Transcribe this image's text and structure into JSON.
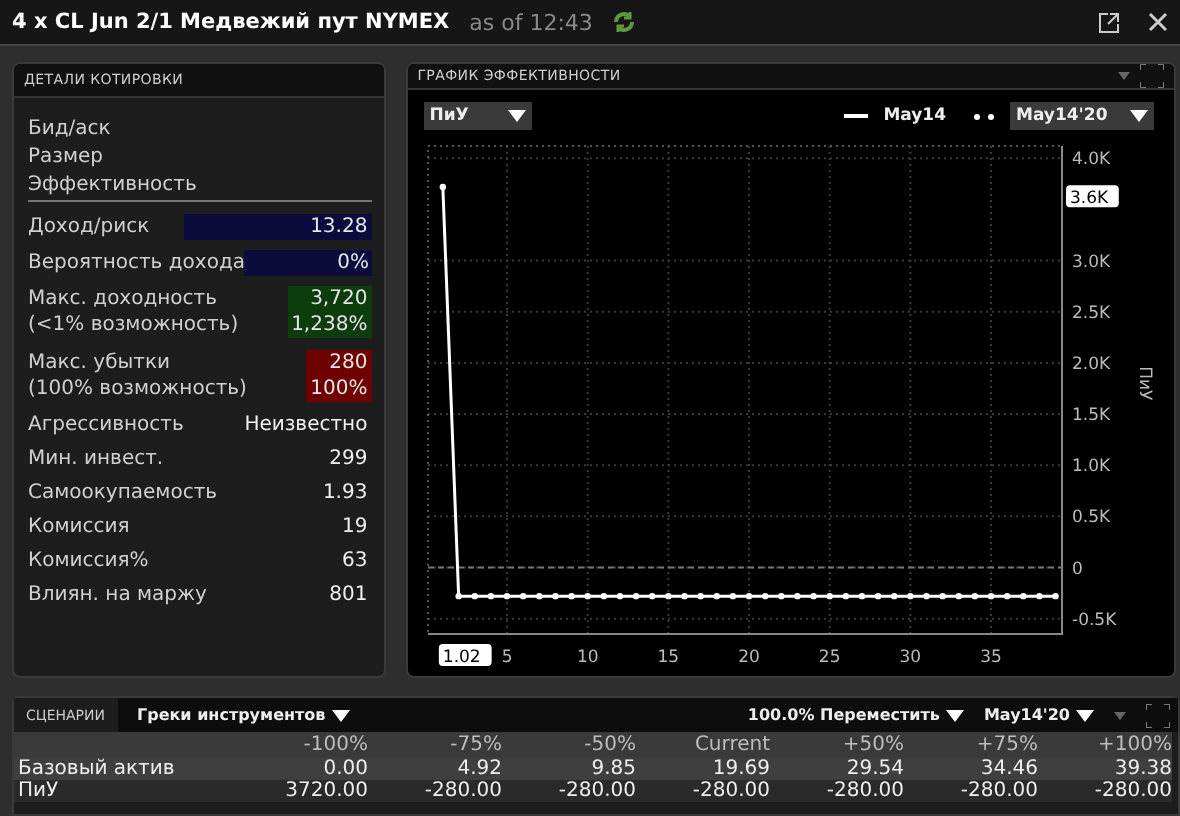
{
  "header": {
    "title": "4 x CL Jun 2/1 Медвежий пут NYMEX",
    "timestamp": "as of 12:43"
  },
  "quote_details": {
    "title": "ДЕТАЛИ КОТИРОВКИ",
    "rows": [
      {
        "kind": "plain",
        "label": "Бид/аск"
      },
      {
        "kind": "plain",
        "label": "Размер"
      },
      {
        "kind": "section",
        "label": "Эффективность"
      },
      {
        "kind": "metric",
        "label": "Доход/риск",
        "values": [
          "13.28"
        ],
        "color": "#0c0c3c"
      },
      {
        "kind": "metric",
        "label": "Вероятность дохода",
        "values": [
          "0%"
        ],
        "color": "#0c0c3c"
      },
      {
        "kind": "metric",
        "label": "Макс. доходность",
        "sublabel": "(<1% возможность)",
        "values": [
          "3,720",
          "1,238%"
        ],
        "color": "#0d3d0d"
      },
      {
        "kind": "metric",
        "label": "Макс. убытки",
        "sublabel": "(100% возможность)",
        "values": [
          "280",
          "100%"
        ],
        "color": "#6e0000"
      },
      {
        "kind": "value",
        "label": "Агрессивность",
        "values": [
          "Неизвестно"
        ]
      },
      {
        "kind": "value",
        "label": "Мин. инвест.",
        "values": [
          "299"
        ]
      },
      {
        "kind": "value",
        "label": "Самоокупаемость",
        "values": [
          "1.93"
        ]
      },
      {
        "kind": "value",
        "label": "Комиссия",
        "values": [
          "19"
        ]
      },
      {
        "kind": "value",
        "label": "Комиссия%",
        "values": [
          "63"
        ]
      },
      {
        "kind": "value",
        "label": "Влиян. на маржу",
        "values": [
          "801"
        ]
      }
    ]
  },
  "performance_chart": {
    "title": "ГРАФИК ЭФФЕКТИВНОСТИ",
    "metric_select": "ПиУ",
    "date_select": "May14'20",
    "chart_data": {
      "type": "line",
      "ylabel": "ПиУ",
      "xlim": [
        0.1,
        39.4
      ],
      "ylim": [
        -650,
        4120
      ],
      "x": [
        1.02,
        2,
        3,
        4,
        5,
        6,
        7,
        8,
        9,
        10,
        11,
        12,
        13,
        14,
        15,
        16,
        17,
        18,
        19,
        20,
        21,
        22,
        23,
        24,
        25,
        26,
        27,
        28,
        29,
        30,
        31,
        32,
        33,
        34,
        35,
        36,
        37,
        38,
        39
      ],
      "grid": true,
      "ref_lines": [
        {
          "axis": "y",
          "value": 0
        }
      ],
      "series": [
        {
          "name": "May14",
          "color": "#ffffff",
          "marker": "o",
          "values": [
            3720,
            -280,
            -280,
            -280,
            -280,
            -280,
            -280,
            -280,
            -280,
            -280,
            -280,
            -280,
            -280,
            -280,
            -280,
            -280,
            -280,
            -280,
            -280,
            -280,
            -280,
            -280,
            -280,
            -280,
            -280,
            -280,
            -280,
            -280,
            -280,
            -280,
            -280,
            -280,
            -280,
            -280,
            -280,
            -280,
            -280,
            -280,
            -280
          ]
        }
      ],
      "xticks": [
        5,
        10,
        15,
        20,
        25,
        30,
        35
      ],
      "yticks": [
        {
          "value": -500,
          "label": "-0.5K"
        },
        {
          "value": 0,
          "label": "0"
        },
        {
          "value": 500,
          "label": "0.5K"
        },
        {
          "value": 1000,
          "label": "1.0K"
        },
        {
          "value": 1500,
          "label": "1.5K"
        },
        {
          "value": 2000,
          "label": "2.0K"
        },
        {
          "value": 2500,
          "label": "2.5K"
        },
        {
          "value": 3000,
          "label": "3.0K"
        },
        {
          "value": 4000,
          "label": "4.0K"
        }
      ],
      "annotations": [
        {
          "y": 3620,
          "text": "3.6K"
        },
        "1.02"
      ]
    }
  },
  "scenarios": {
    "tabs": [
      {
        "label": "СЦЕНАРИИ",
        "selected": true
      }
    ],
    "greeks_select": "Греки инструментов",
    "shift_select": "100.0% Переместить",
    "date_select": "May14'20",
    "table": {
      "columns": [
        "-100%",
        "-75%",
        "-50%",
        "Current",
        "+50%",
        "+75%",
        "+100%"
      ],
      "rows": [
        {
          "label": "Базовый актив",
          "cells": [
            "0.00",
            "4.92",
            "9.85",
            "19.69",
            "29.54",
            "34.46",
            "39.38"
          ]
        },
        {
          "label": "ПиУ",
          "cells": [
            "3720.00",
            "-280.00",
            "-280.00",
            "-280.00",
            "-280.00",
            "-280.00",
            "-280.00"
          ]
        }
      ]
    }
  }
}
